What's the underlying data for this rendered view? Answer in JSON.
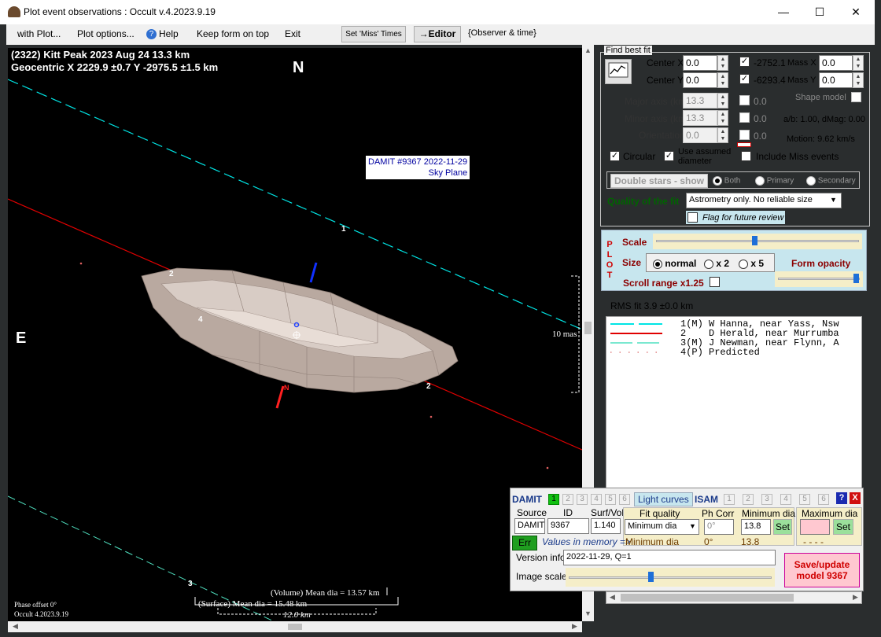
{
  "window": {
    "title": "Plot event observations : Occult v.4.2023.9.19",
    "minimize": "—",
    "maximize": "☐",
    "close": "✕"
  },
  "menu": {
    "with_plot": "with Plot...",
    "plot_options": "Plot options...",
    "help": "Help",
    "keep_on_top": "Keep form on top",
    "exit": "Exit",
    "set_miss_times": "Set 'Miss' Times",
    "editor": "→Editor",
    "observer_time": "{Observer & time}"
  },
  "plot": {
    "header_line1": "(2322) Kitt Peak  2023 Aug 24   13.3 km",
    "header_line2": "Geocentric  X  2229.9 ±0.7  Y -2975.5 ±1.5 km",
    "north": "N",
    "east": "E",
    "damit_label_line1": "DAMIT #9367 2022-11-29",
    "damit_label_line2": "Sky Plane",
    "chord_labels": [
      "1",
      "2",
      "2",
      "4",
      "3"
    ],
    "north_marker": "N",
    "scale_mas": "10 mas",
    "volume_dia": "(Volume) Mean dia = 13.57 km",
    "surface_dia": "(Surface) Mean dia = 15.48 km",
    "scale_km": "12.0 km",
    "phase_offset": "Phase offset 0°",
    "version": "Occult 4.2023.9.19"
  },
  "fit": {
    "group_title": "Find best fit",
    "center_x_label": "Center X",
    "center_x": "0.0",
    "center_y_label": "Center Y",
    "center_y": "0.0",
    "x_value": "-2752.1",
    "y_value": "-6293.4",
    "mass_x_label": "Mass X",
    "mass_x": "0.0",
    "mass_y_label": "Mass Y",
    "mass_y": "0.0",
    "major_axis_label": "Major axis (km)",
    "major_axis": "13.3",
    "major_alt": "0.0",
    "minor_axis_label": "Minor axis (km)",
    "minor_axis": "13.3",
    "minor_alt": "0.0",
    "orientation_label": "Orientation",
    "orientation": "0.0",
    "orient_alt": "0.0",
    "shape_model": "Shape model",
    "ab_dmag": "a/b: 1.00, dMag: 0.00",
    "motion": "Motion: 9.62 km/s",
    "circular": "Circular",
    "use_assumed_line1": "Use assumed",
    "use_assumed_line2": "diameter",
    "include_miss": "Include Miss events",
    "double_stars": "Double stars - show",
    "both": "Both",
    "primary": "Primary",
    "secondary": "Secondary",
    "quality_label": "Quality of the fit",
    "quality_value": "Astrometry only. No reliable size",
    "flag_review": "Flag for future review"
  },
  "plotbox": {
    "vertical": [
      "P",
      "L",
      "O",
      "T"
    ],
    "scale": "Scale",
    "size": "Size",
    "normal": "normal",
    "x2": "x 2",
    "x5": "x 5",
    "form_opacity": "Form opacity",
    "scroll_range": "Scroll range x1.25",
    "scale_level": 0.5,
    "opacity_level": 1.0
  },
  "rms": "RMS fit 3.9 ±0.0 km",
  "legend": [
    {
      "num": "1",
      "code": "(M)",
      "observer": "W Hanna, near Yass, Nsw",
      "color": "#00e5e5",
      "style": "dashed"
    },
    {
      "num": "2",
      "code": "   ",
      "observer": "D Herald, near Murrumba",
      "color": "#e00000",
      "style": "solid"
    },
    {
      "num": "3",
      "code": "(M)",
      "observer": "J Newman, near Flynn, A",
      "color": "#4fe0c0",
      "style": "dashed-thin"
    },
    {
      "num": "4",
      "code": "(P)",
      "observer": "Predicted",
      "color": "#e08080",
      "style": "dots"
    }
  ],
  "damit": {
    "title": "DAMIT",
    "numbers": [
      "1",
      "2",
      "3",
      "4",
      "5",
      "6"
    ],
    "light_curves": "Light curves",
    "isam": "ISAM",
    "isam_numbers": [
      "1",
      "2",
      "3",
      "4",
      "5",
      "6"
    ],
    "help": "?",
    "close": "X",
    "source_label": "Source",
    "id_label": "ID",
    "surfvol_label": "Surf/Vol",
    "source": "DAMIT",
    "id": "9367",
    "surfvol": "1.140",
    "fit_quality_label": "Fit quality",
    "ph_corr_label": "Ph Corr",
    "min_dia_label": "Minimum dia",
    "max_dia_label": "Maximum dia",
    "fit_quality_value": "Minimum dia",
    "ph_corr_value": "0°",
    "min_dia_value": "13.8",
    "set": "Set",
    "err": "Err",
    "values_in_memory": "Values in memory =>",
    "mem_fit": "Minimum dia",
    "mem_ph": "0°",
    "mem_min": "13.8",
    "mem_max": "- - - -",
    "version_info_label": "Version info",
    "version_info": "2022-11-29, Q=1",
    "image_scale_label": "Image scale",
    "save_update_line1": "Save/update",
    "save_update_line2": "model 9367",
    "image_scale_level": 0.4
  }
}
